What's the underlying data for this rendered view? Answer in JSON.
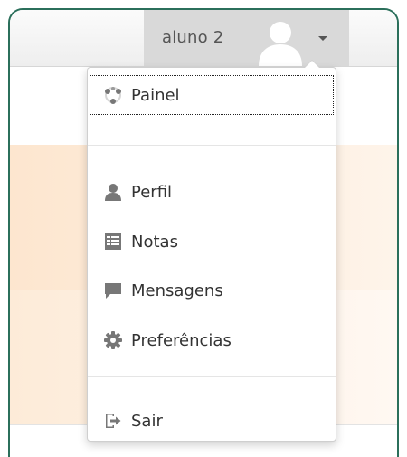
{
  "header": {
    "user_name": "aluno 2"
  },
  "user_menu": {
    "items": [
      {
        "label": "Painel",
        "icon": "dashboard-icon"
      },
      {
        "label": "Perfil",
        "icon": "user-icon"
      },
      {
        "label": "Notas",
        "icon": "grades-icon"
      },
      {
        "label": "Mensagens",
        "icon": "message-icon"
      },
      {
        "label": "Preferências",
        "icon": "gear-icon"
      },
      {
        "label": "Sair",
        "icon": "logout-icon"
      }
    ]
  },
  "colors": {
    "frame_border": "#2b6f5b",
    "toggle_bg": "#d9d9d9",
    "icon_gray": "#777777",
    "text": "#333333"
  }
}
